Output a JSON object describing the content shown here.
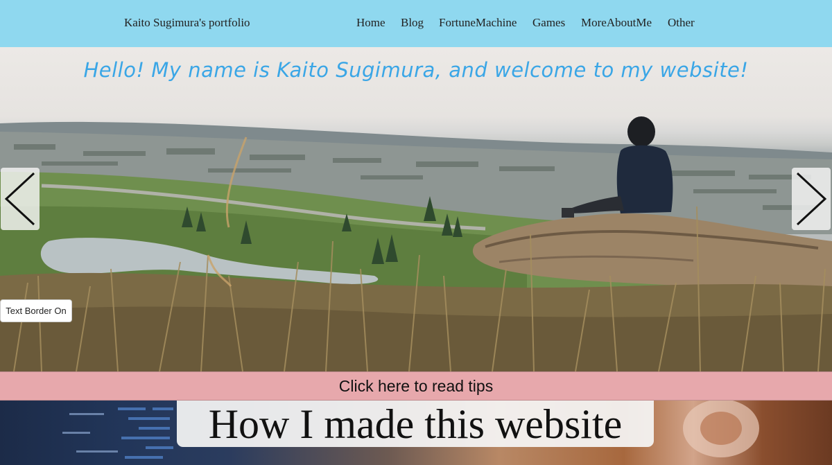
{
  "header": {
    "site_title": "Kaito Sugimura's portfolio",
    "nav": [
      {
        "label": "Home"
      },
      {
        "label": "Blog"
      },
      {
        "label": "FortuneMachine"
      },
      {
        "label": "Games"
      },
      {
        "label": "MoreAboutMe"
      },
      {
        "label": "Other"
      }
    ]
  },
  "hero": {
    "greeting": "Hello! My name is Kaito Sugimura, and welcome to my website!",
    "prev_icon": "chevron-left-icon",
    "next_icon": "chevron-right-icon",
    "text_border_toggle": "Text Border On"
  },
  "tips": {
    "label": "Click here to read tips"
  },
  "article": {
    "title": "How I made this website"
  },
  "colors": {
    "nav_bg": "#8fd8ef",
    "greeting_text": "#3aa6e6",
    "tips_bg": "#e7a8ac"
  }
}
